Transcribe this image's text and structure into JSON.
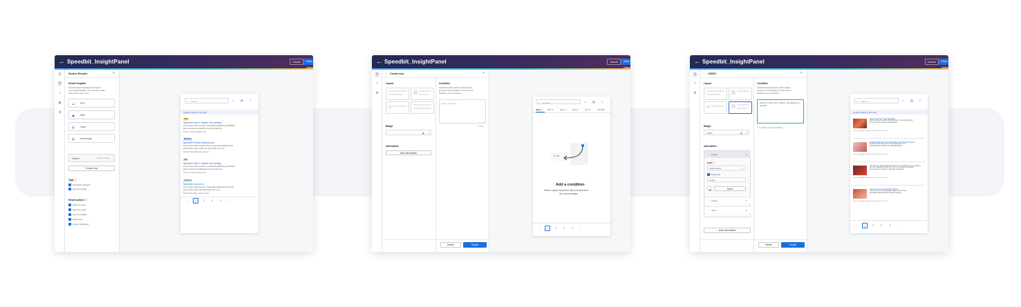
{
  "app": {
    "title": "Speedbit_InsightPanel",
    "cancel": "Cancel",
    "save": "Save changes"
  },
  "w1": {
    "panel_title": "Search Results",
    "section": "Result template",
    "desc1": "Find all result templates that match",
    "desc2": "your content below. You can also create",
    "desc3": "new ones. ",
    "learn": "Learn more",
    "templates": [
      "PDF",
      "Web",
      "Case",
      "Knowledge"
    ],
    "default_label": "Default",
    "default_tag": "All other results",
    "create_new": "Create new",
    "tags_label": "Tags",
    "tags": [
      "Popularity indicator",
      "Recommended"
    ],
    "actions_label": "Result actions",
    "actions": [
      "Attach to case",
      "Send by email",
      "Send to Chatter",
      "Quick view",
      "Copy to clipboard"
    ],
    "search_placeholder": "Search...",
    "context": "Insights related to this case",
    "results": [
      {
        "tag": "WEB",
        "title": "Speedbit Year 1 tracker not working",
        "body": [
          "Lorem ipsum dolor sit amet, consectetur adipiscing elit. Blandit",
          "quam sed amet ac dignissim metus tincidunt ac",
          "Product: Tracks   Visibility: Hub"
        ]
      },
      {
        "tag": "MANUAL",
        "title": "Speedbit Tracker Manual.pdf",
        "body": [
          "Lorem ipsum dolor sit amet, lorem consectetur adipiscing elit.",
          "Morbi quam amet, mollis cras accumsan mus. Leo",
          "Related: Speedbit tracker manual"
        ]
      },
      {
        "tag": "PDF",
        "title": "Speedbit Year 1 tracker not working",
        "body": [
          "Lorem ipsum dolor sit amet, consectetur adipiscing elit. Blandit",
          "quam sed amet ac dignissim metus tincidunt ac",
          "Product: Tracks   Visibility: Hub"
        ]
      },
      {
        "tag": "ARTICLE",
        "title": "Speedbit Connect 2",
        "body": [
          "Lorem ipsum dolor sit amet, consectetur adipiscing elit. Morbi",
          "quam amet, mollis cras accumsan mus. Leo",
          "Related: Speedbit tracker manual"
        ]
      }
    ],
    "pages": [
      "1",
      "2",
      "3",
      "4"
    ]
  },
  "w2": {
    "panel_title": "Create new",
    "layout_label": "Layout",
    "badge_label": "Badge",
    "information_label": "Information",
    "add_info": "Add information",
    "condition_label": "Condition",
    "cond_desc1": "Conditions will determine which results",
    "cond_desc2": "are part of this template. You can edit or",
    "cond_desc3": "build the ",
    "cond_link": "query expression",
    "query_placeholder": "Query expression",
    "counter": "0 / 300",
    "delete": "Delete",
    "create": "Create",
    "search_placeholder": "Speedbit",
    "tabs": [
      "Item 1",
      "Item 2",
      "Item 3",
      "Item 4",
      "Item 5",
      "Left Tab"
    ],
    "empty_title": "Add a condition",
    "empty_desc1": "Paste a query expression that corresponds to",
    "empty_desc2": "this result template",
    "pages": [
      "1",
      "2",
      "3",
      "4"
    ]
  },
  "w3": {
    "panel_title": "VIDEO",
    "layout_label": "Layout",
    "badge_label": "Badge",
    "badge_value": "VIDEO",
    "information_label": "Information",
    "info_rows": [
      "Length",
      "Length",
      "Views"
    ],
    "field_label": "Field",
    "field_value": "duration/length",
    "include_title": "Include title",
    "title_value": "Length",
    "done": "Done",
    "add_info": "Add information",
    "condition_label": "Condition",
    "cond_desc1": "Conditions will determine which results",
    "cond_desc2": "are part of this template. You can edit or",
    "cond_desc3": "build the ",
    "cond_link": "query expression",
    "query_value": "@source==\"demo-video\"==@sysfi... @image(@ysrc) / segments",
    "cond_ok": "Condition has been defined",
    "delete": "Delete",
    "create": "Create",
    "search_placeholder": "Search...",
    "context": "Insights related to this case",
    "videos": [
      {
        "title": "How to Set Up Your Speedbit",
        "lines": [
          "With the help of an NBA x Portable Stats™ we're showcasing",
          "every tool from pairing to functionalities.",
          "Source: Speedbit Youtube   Length: 3:54   Views: 2.2k"
        ]
      },
      {
        "title": "Rotate Wallpaper Speedbit Watch and Rotate Speed",
        "lines": [
          "In this video we show how to rotate watch face, the",
          "Rotate Speedbit watch on the Speedbit Watch.",
          "Source: Speedbit Youtube   Length: 1:45   Views: 802"
        ]
      },
      {
        "title": "Introducing Speedbit Smartwatch for Healthy Use and Drive",
        "lines": [
          "Give your Speedbit a heart rate zone. In the body, the strength",
          "and endurance program of Speedbit smartwatch.",
          "Source: Speedbit Youtube   Length: 2:41   Views: 5.6k"
        ]
      },
      {
        "title": "How To Use the Speedbit Tracker",
        "lines": [
          "Learn how to set your Speedbit tracker to your video",
          "Compatible with Android and iPhone tracking",
          "Source: Speedbit Youtube   Length: 4:10   Views: 1.2k"
        ]
      }
    ],
    "pages": [
      "1",
      "2",
      "3",
      "4"
    ]
  }
}
